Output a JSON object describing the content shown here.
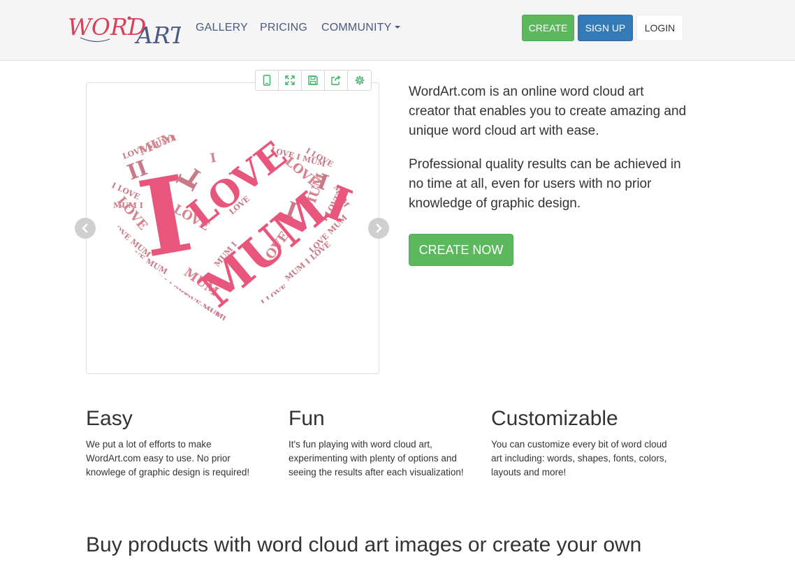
{
  "brand": {
    "logo_part1": "WORD",
    "logo_part2": "ART",
    "logo_colors": {
      "word": "#d9415a",
      "art": "#4a5a82"
    }
  },
  "nav": {
    "links": [
      "GALLERY",
      "PRICING",
      "COMMUNITY"
    ],
    "community_has_dropdown": true,
    "create_label": "CREATE",
    "signup_label": "SIGN UP",
    "login_label": "LOGIN"
  },
  "preview": {
    "toolbar_icons": [
      "tablet-icon",
      "fullscreen-icon",
      "save-icon",
      "share-icon",
      "settings-icon"
    ],
    "prev_icon": "chevron-left-icon",
    "next_icon": "chevron-right-icon",
    "wordcloud_words": [
      "I",
      "LOVE",
      "MUM"
    ]
  },
  "intro": {
    "paragraph1": "WordArt.com is an online word cloud art creator that enables you to create amazing and unique word cloud art with ease.",
    "paragraph2": "Professional quality results can be achieved in no time at all, even for users with no prior knowledge of graphic design.",
    "cta_label": "CREATE NOW"
  },
  "features": [
    {
      "title": "Easy",
      "text": "We put a lot of efforts to make WordArt.com easy to use. No prior knowlege of graphic design is required!"
    },
    {
      "title": "Fun",
      "text": "It's fun playing with word cloud art, experimenting with plenty of options and seeing the results after each visualization!"
    },
    {
      "title": "Customizable",
      "text": "You can customize every bit of word cloud art including: words, shapes, fonts, colors, layouts and more!"
    }
  ],
  "products": {
    "title": "Buy products with word cloud art images or create your own"
  },
  "colors": {
    "primary_green": "#5cb85c",
    "primary_blue": "#337ab7",
    "nav_text": "#4a5a82",
    "cloud_pink": "#e8567c",
    "cloud_dusty": "#c97a88"
  }
}
